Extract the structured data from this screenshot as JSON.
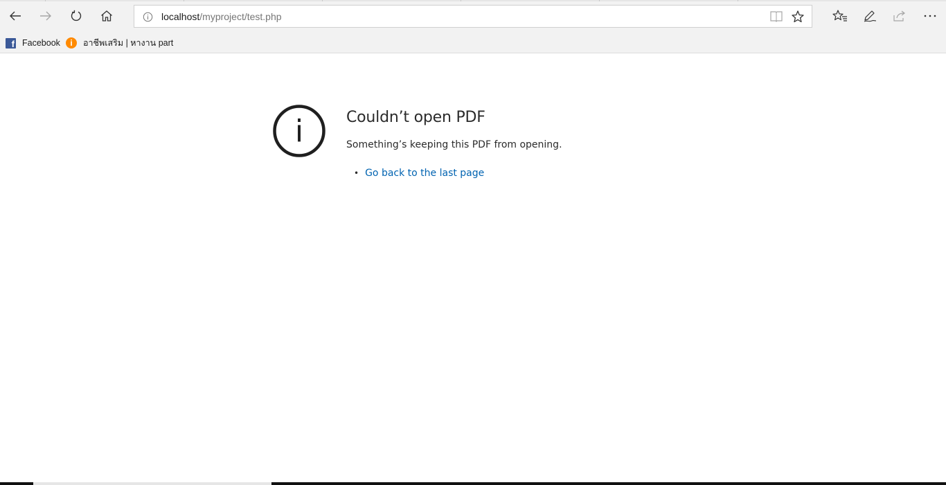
{
  "browser": {
    "nav": {
      "back_icon": "back-arrow-icon",
      "forward_icon": "forward-arrow-icon",
      "refresh_icon": "refresh-icon",
      "home_icon": "home-icon"
    },
    "address": {
      "host": "localhost",
      "path": "/myproject/test.php"
    },
    "toolbar": {
      "icons": [
        "favorites-icon",
        "pen-icon",
        "share-icon",
        "more-icon"
      ]
    },
    "favorites": [
      {
        "label": "Facebook",
        "icon": "facebook-icon",
        "glyph": "f"
      },
      {
        "label": "อาชีพเสริม | หางาน part",
        "icon": "jobs-site-icon",
        "glyph": "i"
      }
    ]
  },
  "error": {
    "icon": "info-circle-icon",
    "icon_glyph": "i",
    "title": "Couldn’t open PDF",
    "message": "Something’s keeping this PDF from opening.",
    "actions": [
      {
        "label": "Go back to the last page"
      }
    ]
  },
  "colors": {
    "chrome": "#f2f2f2",
    "link": "#0063b1",
    "text": "#2b2b2b",
    "facebook": "#3b5998",
    "jobs_badge": "#ff8a00"
  }
}
